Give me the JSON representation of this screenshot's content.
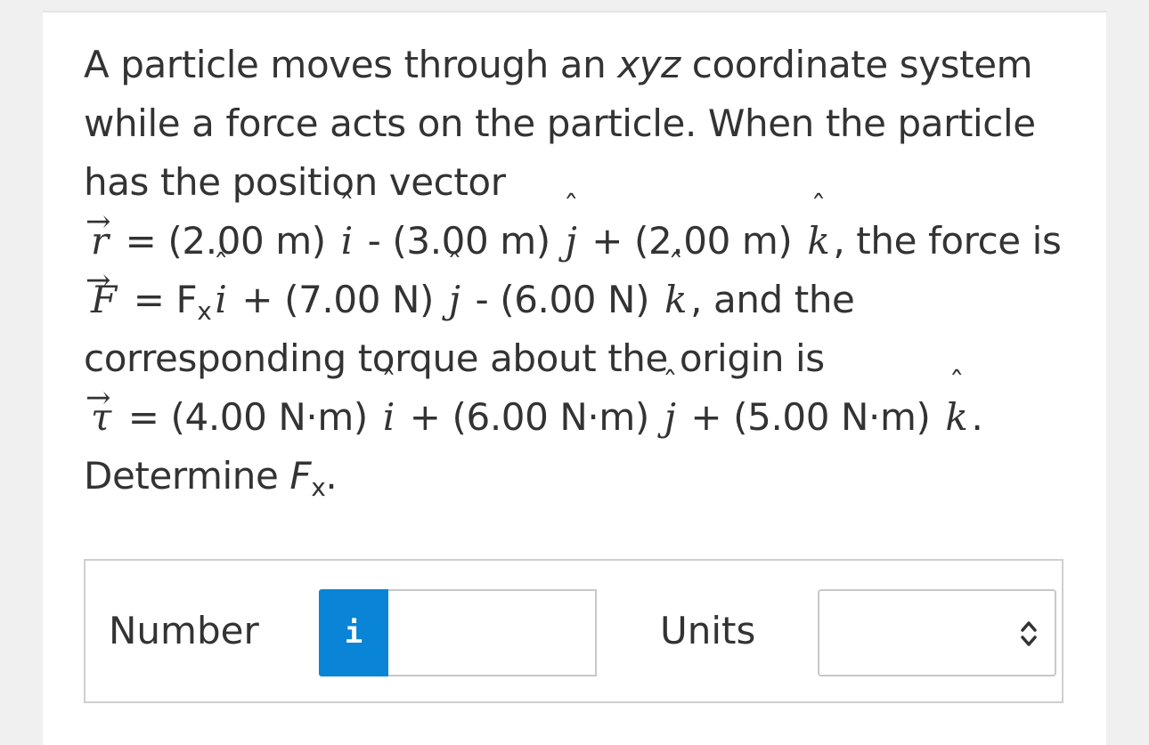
{
  "question": {
    "line1": "A particle moves through an ",
    "line1_xyz": "xyz",
    "line1_end": " coordinate system",
    "line2": "while a force acts on the particle. When the particle",
    "line3": "has the position vector",
    "r_symbol": "r",
    "r_eq": " = (2.00 m) ",
    "r_mid1": " - (3.00 m) ",
    "r_mid2": " + (2.00 m) ",
    "r_end": ", the force is",
    "f_symbol": "F",
    "f_eq": " = F",
    "f_sub": "x",
    "f_mid1": " + (7.00 N) ",
    "f_mid2": " - (6.00 N) ",
    "f_end": ", and the",
    "line6": "corresponding torque about the origin is",
    "t_symbol": "τ",
    "t_eq": " = (4.00 N·m) ",
    "t_mid1": " + (6.00 N·m) ",
    "t_mid2": " + (5.00 N·m) ",
    "t_end": ".",
    "det": "Determine ",
    "det_F": "F",
    "det_sub": "x",
    "det_end": ".",
    "i_hat": "i",
    "j_hat": "j",
    "k_hat": "k"
  },
  "answer": {
    "number_label": "Number",
    "info_icon_glyph": "i",
    "number_value": "",
    "units_label": "Units",
    "units_value": ""
  },
  "colors": {
    "info_button": "#0a84d6",
    "text": "#333333",
    "border": "#cfcfcf"
  }
}
